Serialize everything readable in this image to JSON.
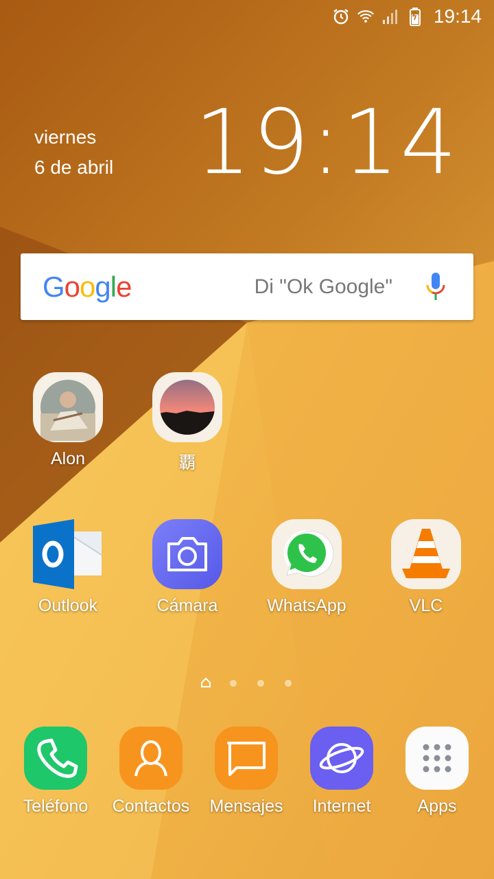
{
  "status_bar": {
    "time": "19:14",
    "icons": [
      "alarm-icon",
      "wifi-icon",
      "signal-icon",
      "battery-icon"
    ]
  },
  "clock_widget": {
    "day": "viernes",
    "date": "6 de abril",
    "time": "19:14"
  },
  "google_bar": {
    "logo": "Google",
    "hint": "Di \"Ok Google\"",
    "icon": "microphone-icon"
  },
  "contacts_row": [
    {
      "label": "Alon",
      "icon": "contact-photo-alon"
    },
    {
      "label": "覇",
      "icon": "contact-photo-sunset"
    }
  ],
  "apps_row": [
    {
      "label": "Outlook",
      "icon": "outlook-icon"
    },
    {
      "label": "Cámara",
      "icon": "camera-icon"
    },
    {
      "label": "WhatsApp",
      "icon": "whatsapp-icon"
    },
    {
      "label": "VLC",
      "icon": "vlc-icon"
    }
  ],
  "page_indicator": {
    "pages": 4,
    "current": 1
  },
  "dock": [
    {
      "label": "Teléfono",
      "icon": "phone-icon"
    },
    {
      "label": "Contactos",
      "icon": "contacts-icon"
    },
    {
      "label": "Mensajes",
      "icon": "messages-icon"
    },
    {
      "label": "Internet",
      "icon": "internet-icon"
    },
    {
      "label": "Apps",
      "icon": "apps-grid-icon"
    }
  ],
  "colors": {
    "wallpaper_dark": "#b8651a",
    "wallpaper_light": "#f3b54c",
    "phone_green": "#1ec76a",
    "contacts_orange": "#f7941e",
    "internet_purple": "#6a5ff0",
    "camera_purple": "#6a6ef2",
    "whatsapp_green": "#2fc24a",
    "outlook_blue": "#0a72c9"
  }
}
